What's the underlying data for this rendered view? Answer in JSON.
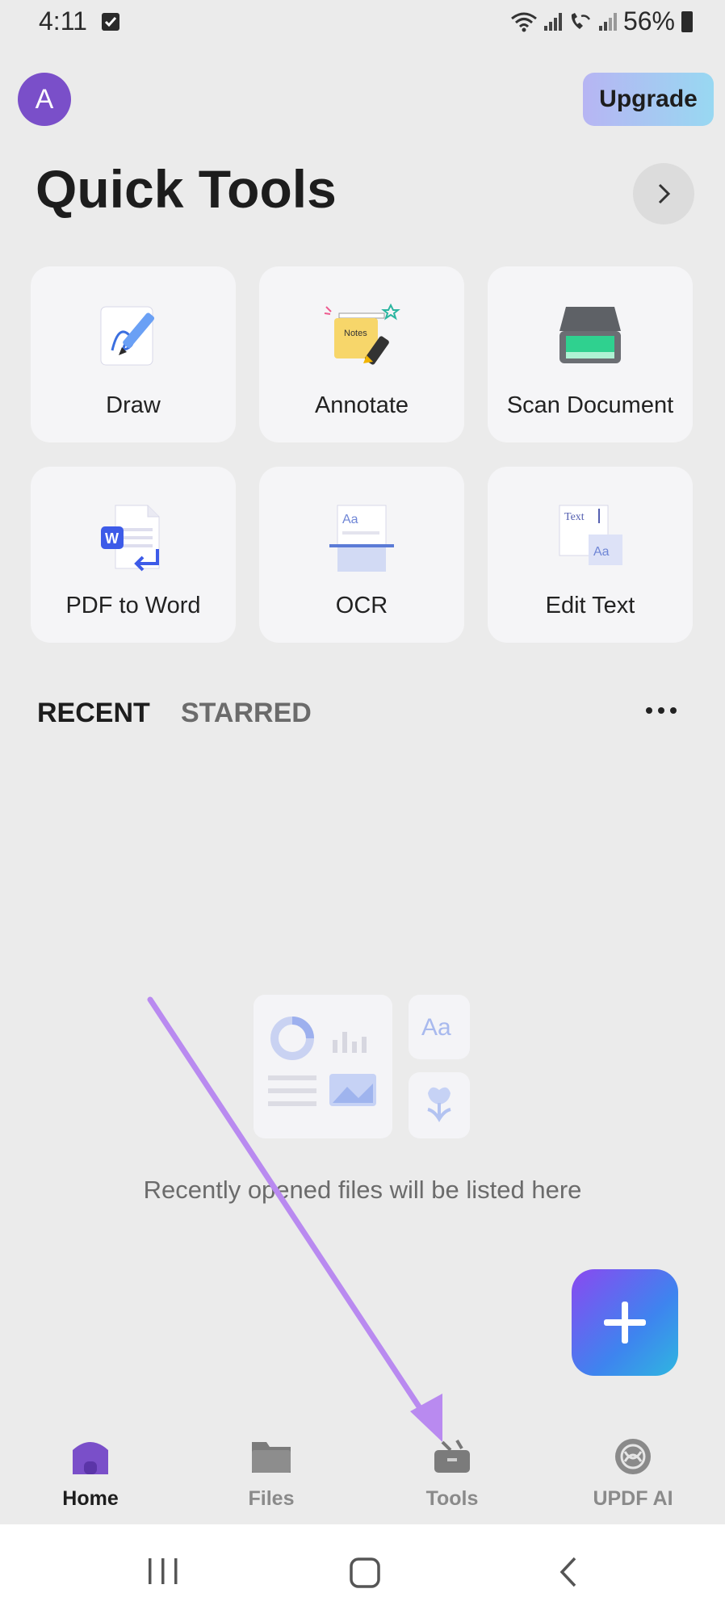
{
  "status_bar": {
    "time": "4:11",
    "battery": "56%"
  },
  "header": {
    "avatar_letter": "A",
    "upgrade_label": "Upgrade",
    "title": "Quick Tools"
  },
  "tools": [
    {
      "label": "Draw",
      "icon": "draw-icon"
    },
    {
      "label": "Annotate",
      "icon": "annotate-icon"
    },
    {
      "label": "Scan Document",
      "icon": "scanner-icon"
    },
    {
      "label": "PDF to Word",
      "icon": "pdf-to-word-icon"
    },
    {
      "label": "OCR",
      "icon": "ocr-icon"
    },
    {
      "label": "Edit Text",
      "icon": "edit-text-icon"
    }
  ],
  "icon_text": {
    "notes": "Notes",
    "word_badge": "W",
    "ocr_aa": "Aa",
    "edit_text": "Text",
    "edit_aa": "Aa",
    "empty_aa": "Aa"
  },
  "tabs": {
    "recent": "RECENT",
    "starred": "STARRED"
  },
  "empty_state": {
    "message": "Recently opened files will be listed here"
  },
  "bottom_nav": [
    {
      "label": "Home",
      "icon": "home-icon",
      "active": true
    },
    {
      "label": "Files",
      "icon": "folder-icon",
      "active": false
    },
    {
      "label": "Tools",
      "icon": "toolbox-icon",
      "active": false
    },
    {
      "label": "UPDF AI",
      "icon": "ai-icon",
      "active": false
    }
  ],
  "colors": {
    "accent": "#7a4fc9",
    "background": "#ebebeb",
    "annotation_arrow": "#b98af0"
  }
}
